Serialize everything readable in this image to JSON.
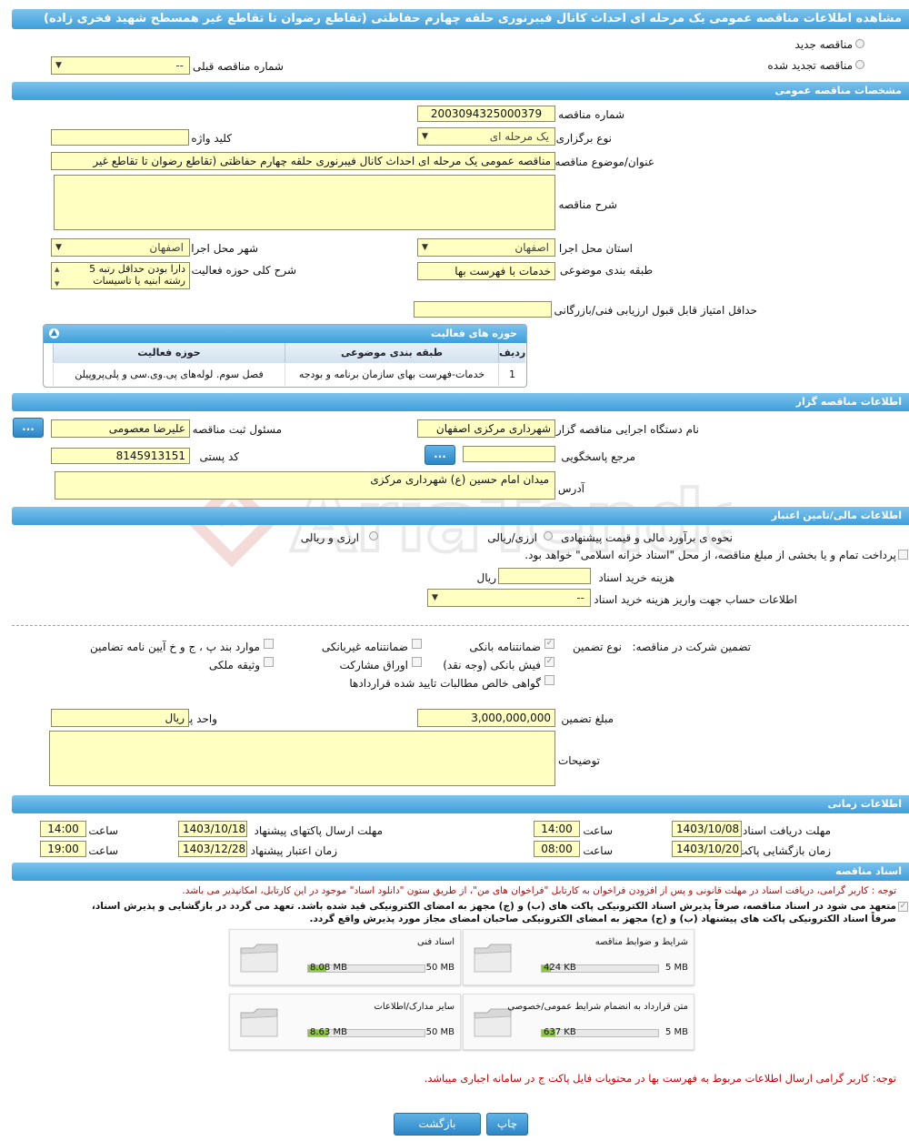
{
  "title": "مشاهده اطلاعات مناقصه عمومی یک مرحله ای احداث کانال فیبرنوری حلقه چهارم حفاظتی (تقاطع رضوان تا تقاطع غیر همسطح شهید فخری زاده)",
  "top": {
    "radio_new": "مناقصه جدید",
    "radio_renewed": "مناقصه تجدید شده",
    "prev_number_label": "شماره مناقصه قبلی",
    "prev_number_value": "--"
  },
  "general": {
    "header": "مشخصات مناقصه عمومی",
    "number_label": "شماره مناقصه",
    "number_value": "2003094325000379",
    "type_label": "نوع برگزاری",
    "type_value": "یک مرحله ای",
    "keyword_label": "کلید واژه",
    "keyword_value": "",
    "subject_label": "عنوان/موضوع مناقصه",
    "subject_value": "مناقصه عمومی یک مرحله ای احداث کانال فیبرنوری حلقه چهارم حفاظتی (تقاطع رضوان تا تقاطع غیر",
    "description_label": "شرح مناقصه",
    "province_label": "استان محل اجرا",
    "province_value": "اصفهان",
    "city_label": "شهر محل اجرا",
    "city_value": "اصفهان",
    "category_label": "طبقه بندی موضوعی",
    "category_value": "خدمات با فهرست بها",
    "activity_desc_label": "شرح کلی حوزه فعالیت",
    "activity_desc_line1": "دارا بودن حداقل رتبه 5",
    "activity_desc_line2": "رشته ابنیه یا تاسیسات",
    "min_score_label": "حداقل امتیاز قابل قبول ارزیابی فنی/بازرگانی",
    "min_score_value": ""
  },
  "activity_grid": {
    "header": "حوزه های فعالیت",
    "col_row": "ردیف",
    "col_category": "طبقه بندی موضوعی",
    "col_field": "حوزه فعالیت",
    "rows": [
      {
        "row": "1",
        "category": "خدمات-فهرست بهای سازمان برنامه و بودجه",
        "field": "فصل سوم. لوله‌های پی.وی.سی و پلی‌پروپیلن"
      }
    ]
  },
  "organizer": {
    "header": "اطلاعات مناقصه گزار",
    "org_label": "نام دستگاه اجرایی مناقصه گزار",
    "org_value": "شهرداری مرکزی اصفهان",
    "registrar_label": "مسئول ثبت مناقصه",
    "registrar_value": "علیرضا معصومی",
    "button_dots": "...",
    "reference_label": "مرجع پاسخگویی",
    "reference_value": "",
    "postal_label": "کد پستی",
    "postal_value": "8145913151",
    "address_label": "آدرس",
    "address_value": "میدان امام حسین (ع) شهرداری مرکزی"
  },
  "finance": {
    "header": "اطلاعات مالی/تامین اعتبار",
    "estimate_label": "نحوه ی برآورد مالی و قیمت پیشنهادی",
    "opt_rial": "ارزی/ریالی",
    "opt_currency": "ارزی و ریالی",
    "treasury_text": "پرداخت تمام و یا بخشی از مبلغ مناقصه، از محل \"اسناد خزانه اسلامی\" خواهد بود.",
    "doc_fee_label": "هزینه خرید اسناد",
    "doc_fee_value": "",
    "doc_fee_unit": "ریال",
    "account_label": "اطلاعات حساب جهت واریز هزینه خرید اسناد",
    "account_value": "--"
  },
  "guarantee": {
    "label": "تضمین شرکت در مناقصه:",
    "type_label": "نوع تضمین",
    "opt_bank_guarantee": "ضمانتنامه بانکی",
    "opt_nonbank_guarantee": "ضمانتنامه غیربانکی",
    "opt_regulation": "موارد بند پ ، ج و خ آیین نامه تضامین",
    "opt_bank_receipt": "فیش بانکی (وجه نقد)",
    "opt_bonds": "اوراق مشارکت",
    "opt_property": "وثیقه ملکی",
    "opt_claims": "گواهی خالص مطالبات تایید شده قراردادها",
    "amount_label": "مبلغ تضمین",
    "amount_value": "3,000,000,000",
    "currency_label": "واحد پول",
    "currency_value": "ریال",
    "notes_label": "توضیحات"
  },
  "timing": {
    "header": "اطلاعات زمانی",
    "receive_label": "مهلت دریافت اسناد",
    "receive_date": "1403/10/08",
    "receive_time": "14:00",
    "submit_label": "مهلت ارسال پاکتهای پیشنهاد",
    "submit_date": "1403/10/18",
    "submit_time": "14:00",
    "opening_label": "زمان بازگشایی پاکت ها",
    "opening_date": "1403/10/20",
    "opening_time": "08:00",
    "validity_label": "زمان اعتبار پیشنهاد",
    "validity_date": "1403/12/28",
    "validity_time": "19:00",
    "time_label": "ساعت"
  },
  "documents": {
    "header": "اسناد مناقصه",
    "note1": "توجه : کاربر گرامی، دریافت اسناد در مهلت قانونی و پس از افزودن فراخوان به کارتابل \"فراخوان های من\"، از طریق ستون \"دانلود اسناد\" موجود در این کارتابل، امکانپذیر می باشد.",
    "commit1": "متعهد می شود در اسناد مناقصه، صرفاً پذیرش اسناد الکترونیکی پاکت های (ب) و (ج) مجهز به امضای الکترونیکی قید شده باشد. تعهد می گردد در بازگشایی و پذیرش اسناد،",
    "commit2": "صرفاً اسناد الکترونیکی پاکت های پیشنهاد (ب) و (ج) مجهز به امضای الکترونیکی صاحبان امضای مجاز مورد پذیرش واقع گردد.",
    "files": [
      {
        "name": "شرایط و ضوابط مناقصه",
        "size": "424 KB",
        "max": "5 MB",
        "fill": 0.08
      },
      {
        "name": "اسناد فنی",
        "size": "8.08 MB",
        "max": "50 MB",
        "fill": 0.16
      },
      {
        "name": "متن قرارداد به انضمام شرایط عمومی/خصوصی",
        "size": "637 KB",
        "max": "5 MB",
        "fill": 0.12
      },
      {
        "name": "سایر مدارک/اطلاعات",
        "size": "8.63 MB",
        "max": "50 MB",
        "fill": 0.17
      }
    ],
    "note2": "توجه: کاربر گرامی ارسال اطلاعات مربوط به فهرست بها در محتویات فایل پاکت ج در سامانه اجباری میباشد."
  },
  "buttons": {
    "print": "چاپ",
    "back": "بازگشت"
  },
  "watermark": "AriaTender.neT",
  "colors": {
    "header_bar": "#3d9fdc",
    "field_bg": "#ffffc2",
    "warning": "#cc0000",
    "progress": "#8cc63f"
  }
}
